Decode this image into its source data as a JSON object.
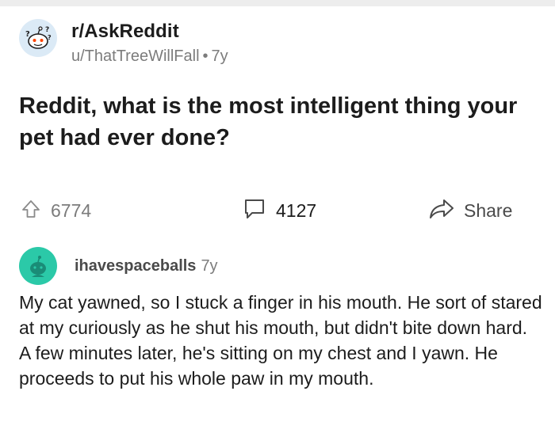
{
  "post": {
    "subreddit": "r/AskReddit",
    "author": "u/ThatTreeWillFall",
    "separator": "•",
    "age": "7y",
    "title": "Reddit, what is the most intelligent thing your pet had ever done?"
  },
  "actions": {
    "upvotes": "6774",
    "comments": "4127",
    "share_label": "Share"
  },
  "comment": {
    "username": "ihavespaceballs",
    "age": "7y",
    "body": "My cat yawned, so I stuck a finger in his mouth. He sort of stared at my curiously as he shut his mouth, but didn't bite down hard. A few minutes later, he's sitting on my chest and I yawn. He proceeds to put his whole paw in my mouth."
  },
  "icons": {
    "subreddit_avatar": "askreddit-snoo-icon",
    "upvote": "upvote-arrow-icon",
    "comments": "comment-bubble-icon",
    "share": "share-arrow-icon",
    "user_avatar": "snoo-avatar-icon"
  },
  "colors": {
    "meta_text": "#7c7c7c",
    "user_avatar_bg": "#2bc9a8",
    "sub_avatar_bg": "#dbeaf6"
  }
}
